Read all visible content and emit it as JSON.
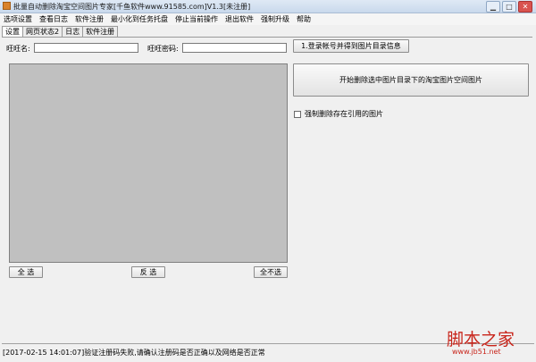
{
  "window": {
    "title": "批量自动删除淘宝空间图片专家[千鱼软件www.91585.com]V1.3[未注册]"
  },
  "menu": [
    "选项设置",
    "查看日志",
    "软件注册",
    "最小化到任务托盘",
    "停止当前操作",
    "退出软件",
    "强制升级",
    "帮助"
  ],
  "tabs": [
    "设置",
    "网页状态2",
    "日志",
    "软件注册"
  ],
  "form": {
    "wangwang_label": "旺旺名:",
    "wangwang_value": "",
    "password_label": "旺旺密码:",
    "password_value": ""
  },
  "buttons": {
    "login": "1.登录帐号并得到图片目录信息",
    "start_delete": "开始删除选中图片目录下的淘宝图片空间图片",
    "select_all": "全  选",
    "invert": "反  选",
    "select_none": "全不选"
  },
  "options": {
    "force_delete_label": "强制删除存在引用的图片",
    "force_delete_checked": false
  },
  "status": "[2017-02-15 14:01:07]验证注册码失败,请确认注册码是否正确以及网络是否正常",
  "watermark": {
    "main": "脚本之家",
    "sub": "www.jb51.net"
  }
}
